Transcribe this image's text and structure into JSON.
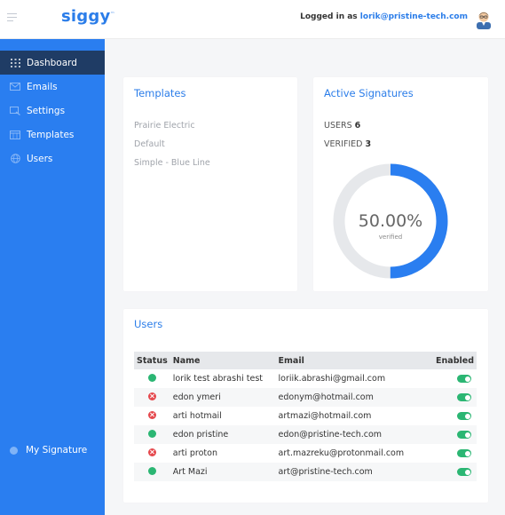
{
  "header": {
    "brand": "siggy",
    "brand_mark": "™",
    "login_prefix": "Logged in as ",
    "login_email": "lorik@pristine-tech.com",
    "avatar_icon": "user-avatar-icon"
  },
  "sidebar": {
    "items": [
      {
        "label": "Dashboard",
        "icon": "grid-icon",
        "active": true
      },
      {
        "label": "Emails",
        "icon": "envelope-icon",
        "active": false
      },
      {
        "label": "Settings",
        "icon": "settings-icon",
        "active": false
      },
      {
        "label": "Templates",
        "icon": "calendar-icon",
        "active": false
      },
      {
        "label": "Users",
        "icon": "globe-icon",
        "active": false
      }
    ],
    "footer_label": "My Signature"
  },
  "templates": {
    "title": "Templates",
    "items": [
      "Prairie Electric",
      "Default",
      "Simple - Blue Line"
    ]
  },
  "signatures": {
    "title": "Active Signatures",
    "users_label": "USERS",
    "users_count": "6",
    "verified_label": "VERIFIED",
    "verified_count": "3",
    "percent_text": "50.00%",
    "percent_caption": "verified",
    "verified_fraction": 0.5,
    "colors": {
      "track": "#e6e8eb",
      "fill": "#2a7ef0"
    }
  },
  "users": {
    "title": "Users",
    "columns": [
      "Status",
      "Name",
      "Email",
      "Enabled"
    ],
    "rows": [
      {
        "status": "ok",
        "name": "lorik test abrashi test",
        "email": "loriik.abrashi@gmail.com",
        "enabled": true
      },
      {
        "status": "error",
        "name": "edon ymeri",
        "email": "edonym@hotmail.com",
        "enabled": true
      },
      {
        "status": "error",
        "name": "arti hotmail",
        "email": "artmazi@hotmail.com",
        "enabled": true
      },
      {
        "status": "ok",
        "name": "edon pristine",
        "email": "edon@pristine-tech.com",
        "enabled": true
      },
      {
        "status": "error",
        "name": "arti proton",
        "email": "art.mazreku@protonmail.com",
        "enabled": true
      },
      {
        "status": "ok",
        "name": "Art Mazi",
        "email": "art@pristine-tech.com",
        "enabled": true
      }
    ]
  },
  "colors": {
    "accent": "#2b7de9",
    "sidebar": "#2a7ef0",
    "sidebar_active": "#1f3c65",
    "ok": "#2bb673",
    "error": "#e5484d"
  }
}
